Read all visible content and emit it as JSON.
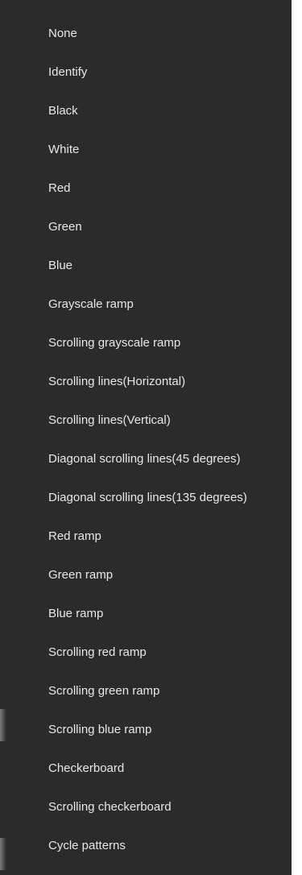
{
  "menu": {
    "items": [
      {
        "label": "None"
      },
      {
        "label": "Identify"
      },
      {
        "label": "Black"
      },
      {
        "label": "White"
      },
      {
        "label": "Red"
      },
      {
        "label": "Green"
      },
      {
        "label": "Blue"
      },
      {
        "label": "Grayscale ramp"
      },
      {
        "label": "Scrolling grayscale ramp"
      },
      {
        "label": "Scrolling lines(Horizontal)"
      },
      {
        "label": "Scrolling lines(Vertical)"
      },
      {
        "label": "Diagonal scrolling lines(45 degrees)"
      },
      {
        "label": "Diagonal scrolling lines(135 degrees)"
      },
      {
        "label": "Red ramp"
      },
      {
        "label": "Green ramp"
      },
      {
        "label": "Blue ramp"
      },
      {
        "label": "Scrolling red ramp"
      },
      {
        "label": "Scrolling green ramp"
      },
      {
        "label": "Scrolling blue ramp"
      },
      {
        "label": "Checkerboard"
      },
      {
        "label": "Scrolling checkerboard"
      },
      {
        "label": "Cycle patterns"
      }
    ]
  },
  "colors": {
    "menu_background": "#2b2b2b",
    "menu_text": "#e8e8e8"
  }
}
